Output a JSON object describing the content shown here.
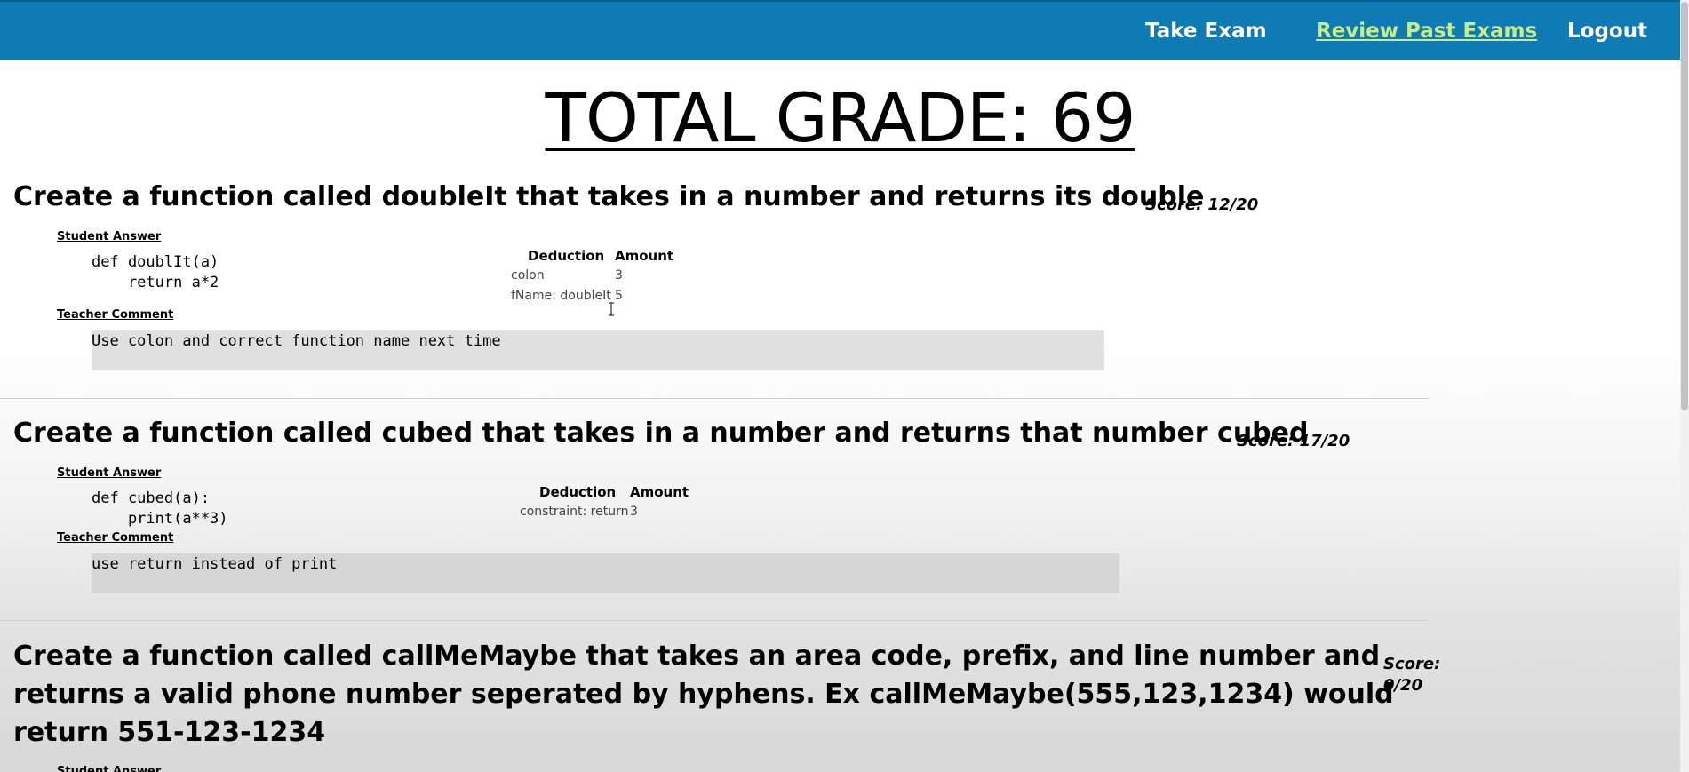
{
  "nav": {
    "take_exam": "Take Exam",
    "review_past_exams": "Review Past Exams",
    "logout": "Logout",
    "active_color": "#c8ec8c",
    "bar_color": "#0e7bb5"
  },
  "total_grade": "TOTAL GRADE: 69",
  "labels": {
    "student_answer": "Student Answer",
    "teacher_comment": "Teacher Comment",
    "deduction": "Deduction",
    "amount": "Amount"
  },
  "questions": [
    {
      "title": "Create a function called doubleIt that takes in a number and returns its double",
      "score": "Score: 12/20",
      "code": "def doublIt(a)\n    return a*2",
      "deductions": [
        {
          "deduction": "colon",
          "amount": "3"
        },
        {
          "deduction": "fName: doubleIt",
          "amount": "5"
        }
      ],
      "comment": "Use colon and correct function name next time"
    },
    {
      "title": "Create a function called cubed that takes in a number and returns that number cubed",
      "score": "Score: 17/20",
      "code": "def cubed(a):\n    print(a**3)",
      "deductions": [
        {
          "deduction": "constraint: return",
          "amount": "3"
        }
      ],
      "comment": "use return instead of print"
    },
    {
      "title_line1": "Create a function called callMeMaybe that takes an area code, prefix, and line number and",
      "title_line2": "returns a valid phone number seperated by hyphens. Ex callMeMaybe(555,123,1234) would",
      "title_line3": "return 551-123-1234",
      "score_line1": "Score:",
      "score_line2": "0/20",
      "student_answer_partial": "Student Answer"
    }
  ]
}
